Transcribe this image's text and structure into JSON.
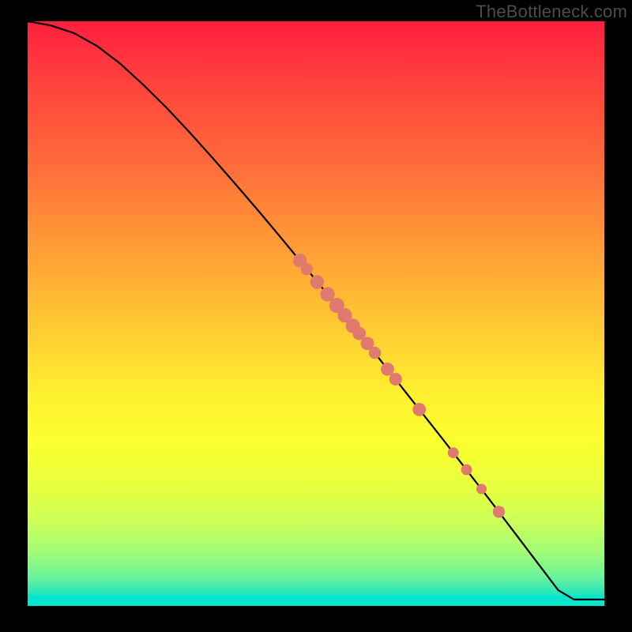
{
  "watermark": "TheBottleneck.com",
  "colors": {
    "dot": "#e07a6f",
    "line": "#000000",
    "gradient_top": "#ff1f3f",
    "gradient_bottom": "#07e5cd",
    "frame": "#000000"
  },
  "chart_data": {
    "type": "line",
    "title": "",
    "xlabel": "",
    "ylabel": "",
    "xlim": [
      0,
      100
    ],
    "ylim": [
      0,
      100
    ],
    "series": [
      {
        "name": "curve",
        "x": [
          0,
          4,
          8,
          12,
          16,
          20,
          24,
          28,
          32,
          36,
          40,
          44,
          48,
          52,
          56,
          60,
          64,
          68,
          72,
          76,
          80,
          84,
          88,
          92,
          94.7,
          100
        ],
        "y": [
          100,
          99.3,
          98.0,
          95.8,
          92.8,
          89.2,
          85.3,
          81.1,
          76.7,
          72.2,
          67.6,
          62.9,
          58.1,
          53.3,
          48.4,
          43.5,
          38.5,
          33.5,
          28.5,
          23.4,
          18.3,
          13.1,
          7.9,
          2.7,
          1.1,
          1.1
        ]
      }
    ],
    "points": [
      {
        "x": 47.2,
        "y": 59.1,
        "r": 1.2
      },
      {
        "x": 48.4,
        "y": 57.6,
        "r": 1.05
      },
      {
        "x": 50.2,
        "y": 55.4,
        "r": 1.2
      },
      {
        "x": 52.0,
        "y": 53.3,
        "r": 1.25
      },
      {
        "x": 53.6,
        "y": 51.4,
        "r": 1.3
      },
      {
        "x": 55.0,
        "y": 49.7,
        "r": 1.25
      },
      {
        "x": 56.4,
        "y": 47.9,
        "r": 1.25
      },
      {
        "x": 57.5,
        "y": 46.6,
        "r": 1.15
      },
      {
        "x": 58.9,
        "y": 44.9,
        "r": 1.15
      },
      {
        "x": 60.2,
        "y": 43.3,
        "r": 1.05
      },
      {
        "x": 62.4,
        "y": 40.5,
        "r": 1.15
      },
      {
        "x": 63.8,
        "y": 38.8,
        "r": 1.1
      },
      {
        "x": 67.9,
        "y": 33.6,
        "r": 1.15
      },
      {
        "x": 73.8,
        "y": 26.2,
        "r": 0.95
      },
      {
        "x": 76.1,
        "y": 23.3,
        "r": 0.95
      },
      {
        "x": 78.7,
        "y": 20.0,
        "r": 0.9
      },
      {
        "x": 81.7,
        "y": 16.1,
        "r": 1.05
      }
    ]
  }
}
